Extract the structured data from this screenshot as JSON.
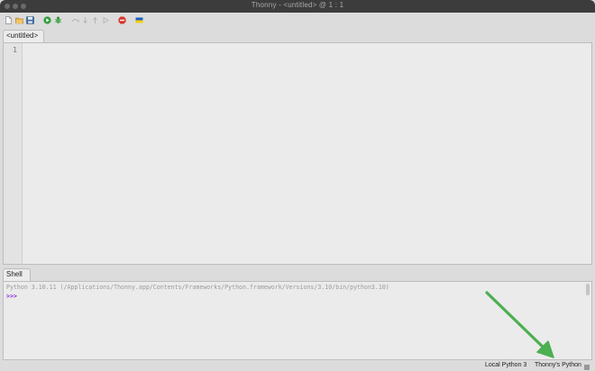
{
  "window": {
    "title": "Thonny  -  <untitled>  @  1 : 1"
  },
  "toolbar": {
    "buttons": [
      {
        "name": "new-file-icon",
        "color": "#f4f4f4"
      },
      {
        "name": "open-file-icon",
        "color": "#e8b44a"
      },
      {
        "name": "save-file-icon",
        "color": "#3a6ea5"
      },
      {
        "name": "run-icon",
        "color": "#2e9e3e"
      },
      {
        "name": "debug-icon",
        "color": "#4caf50"
      },
      {
        "name": "step-over-icon",
        "color": "#b9b9b9"
      },
      {
        "name": "step-into-icon",
        "color": "#b9b9b9"
      },
      {
        "name": "step-out-icon",
        "color": "#b9b9b9"
      },
      {
        "name": "resume-icon",
        "color": "#b9b9b9"
      },
      {
        "name": "stop-icon",
        "color": "#d9352b",
        "label": "STOP"
      },
      {
        "name": "ukraine-flag-icon",
        "colors": [
          "#1f5fbf",
          "#f5d000"
        ]
      }
    ]
  },
  "editor": {
    "tab_label": "<untitled>",
    "line_numbers": [
      "1"
    ]
  },
  "shell": {
    "tab_label": "Shell",
    "banner": "Python 3.10.11 (/Applications/Thonny.app/Contents/Frameworks/Python.framework/Versions/3.10/bin/python3.10)",
    "prompt": ">>>"
  },
  "statusbar": {
    "interpreter_label": "Local Python 3",
    "python_label": "Thonny's Python",
    "menu_icon": "hamburger-icon"
  },
  "annotation": {
    "arrow_color": "#4caf50"
  }
}
